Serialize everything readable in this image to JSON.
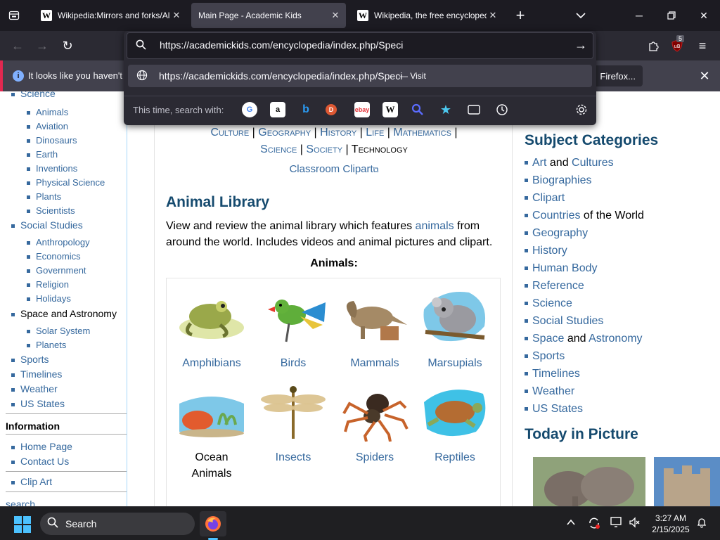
{
  "tabs": [
    {
      "title": "Wikipedia:Mirrors and forks/All",
      "favicon": "W",
      "active": false
    },
    {
      "title": "Main Page - Academic Kids",
      "favicon": "",
      "active": true
    },
    {
      "title": "Wikipedia, the free encyclopedi",
      "favicon": "W",
      "active": false
    }
  ],
  "url_panel": {
    "url_value": "https://academickids.com/encyclopedia/index.php/Speci",
    "suggestion_url": "https://academickids.com/encyclopedia/index.php/Speci",
    "suggestion_action": "— Visit",
    "search_with_label": "This time, search with:",
    "engines": [
      "google-icon",
      "amazon-icon",
      "bing-icon",
      "duckduckgo-icon",
      "ebay-icon",
      "wikipedia-icon",
      "search-engine-icon",
      "bookmarks-icon",
      "tabs-icon",
      "history-icon"
    ]
  },
  "toolbar": {
    "ublock_badge": "5"
  },
  "notification": {
    "text": "It looks like you haven't st",
    "button_label": "Firefox..."
  },
  "left_nav": {
    "top_cut_item": "Science",
    "science_items": [
      "Animals",
      "Aviation",
      "Dinosaurs",
      "Earth",
      "Inventions",
      "Physical Science",
      "Plants",
      "Scientists"
    ],
    "social_studies": "Social Studies",
    "social_items": [
      "Anthropology",
      "Economics",
      "Government",
      "Religion",
      "Holidays"
    ],
    "space": "Space and Astronomy",
    "space_items": [
      "Solar System",
      "Planets"
    ],
    "more_items": [
      "Sports",
      "Timelines",
      "Weather",
      "US States"
    ],
    "information_heading": "Information",
    "info_items": [
      "Home Page",
      "Contact Us"
    ],
    "clip_art": "Clip Art",
    "search_cut": "search"
  },
  "center": {
    "categories_line1": [
      "Culture",
      "Geography",
      "History",
      "Life",
      "Mathematics"
    ],
    "categories_line2": [
      "Science",
      "Society",
      "Technology"
    ],
    "clipart_link": "Classroom Clipart",
    "animal_heading": "Animal Library",
    "para_before": "View and review the animal library which features ",
    "para_link": "animals",
    "para_after": " from around the world. Includes videos and animal pictures and clipart.",
    "animals_label": "Animals:",
    "animals": [
      "Amphibians",
      "Birds",
      "Mammals",
      "Marsupials",
      "Ocean Animals",
      "Insects",
      "Spiders",
      "Reptiles"
    ]
  },
  "right": {
    "subject_heading": "Subject Categories",
    "art_a": "Art",
    "art_and": " and ",
    "art_b": "Cultures",
    "biographies": "Biographies",
    "clipart": "Clipart",
    "countries": "Countries",
    "countries_rest": " of the World",
    "geography": "Geography",
    "history": "History",
    "human_body": "Human Body",
    "reference": "Reference",
    "science": "Science",
    "social_studies": "Social Studies",
    "space_a": "Space",
    "space_and": " and ",
    "space_b": "Astronomy",
    "sports": "Sports",
    "timelines": "Timelines",
    "weather": "Weather",
    "us_states": "US States",
    "today_heading": "Today in Picture"
  },
  "taskbar": {
    "search_label": "Search",
    "time": "3:27 AM",
    "date": "2/15/2025"
  }
}
